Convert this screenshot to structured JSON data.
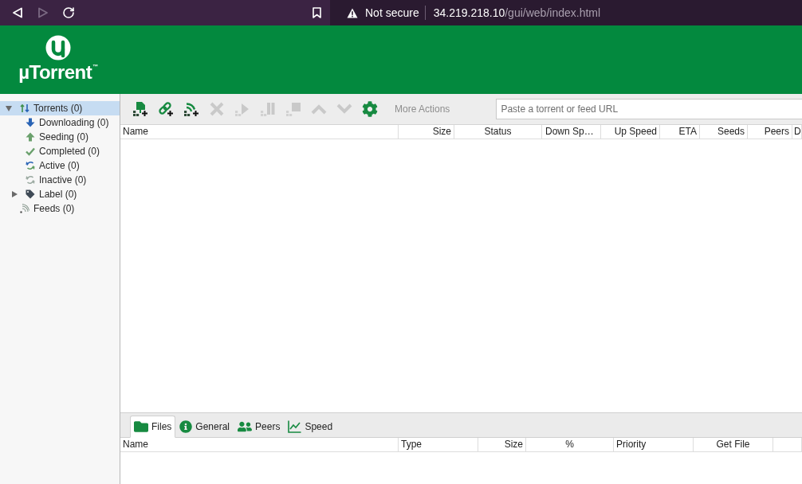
{
  "browser": {
    "nav_buttons": [
      {
        "kind": "back",
        "disabled": false
      },
      {
        "kind": "forward",
        "disabled": true
      },
      {
        "kind": "reload",
        "disabled": false
      }
    ],
    "security_label": "Not secure",
    "url_host": "34.219.218.10",
    "url_path": "/gui/web/index.html"
  },
  "header": {
    "logo_text": "µTorrent",
    "trademark": "™"
  },
  "sidebar": {
    "items": [
      {
        "kind": "torrents",
        "label": "Torrents (0)",
        "selected": true,
        "expanded": true,
        "children": [
          {
            "kind": "downloading",
            "label": "Downloading (0)",
            "selected": false
          },
          {
            "kind": "seeding",
            "label": "Seeding (0)",
            "selected": false
          },
          {
            "kind": "completed",
            "label": "Completed (0)",
            "selected": false
          },
          {
            "kind": "active",
            "label": "Active (0)",
            "selected": false
          },
          {
            "kind": "inactive",
            "label": "Inactive (0)",
            "selected": false
          },
          {
            "kind": "label",
            "label": "Label (0)",
            "selected": false,
            "expanded": false
          }
        ]
      },
      {
        "kind": "feeds",
        "label": "Feeds (0)",
        "selected": false
      }
    ]
  },
  "toolbar": {
    "buttons": [
      {
        "kind": "add",
        "disabled": false
      },
      {
        "kind": "link",
        "disabled": false
      },
      {
        "kind": "feed",
        "disabled": false
      },
      {
        "kind": "remove",
        "disabled": true
      },
      {
        "kind": "start",
        "disabled": true
      },
      {
        "kind": "pause",
        "disabled": true
      },
      {
        "kind": "stop",
        "disabled": true
      },
      {
        "kind": "up",
        "disabled": true
      },
      {
        "kind": "down",
        "disabled": true
      },
      {
        "kind": "settings",
        "disabled": false
      }
    ],
    "more_actions": {
      "label": "More Actions",
      "disabled": true
    },
    "url_field": {
      "placeholder": "Paste a torrent or feed URL"
    }
  },
  "torrent_table": {
    "columns": [
      "Name",
      "Size",
      "Status",
      "Down Sp…",
      "Up Speed",
      "ETA",
      "Seeds",
      "Peers",
      "D"
    ]
  },
  "details": {
    "tabs": [
      {
        "kind": "files",
        "label": "Files",
        "selected": true
      },
      {
        "kind": "general",
        "label": "General",
        "selected": false
      },
      {
        "kind": "peers",
        "label": "Peers",
        "selected": false
      },
      {
        "kind": "speed",
        "label": "Speed",
        "selected": false
      }
    ],
    "files_table": {
      "columns": [
        "Name",
        "Type",
        "Size",
        "%",
        "Priority",
        "Get File"
      ]
    }
  }
}
